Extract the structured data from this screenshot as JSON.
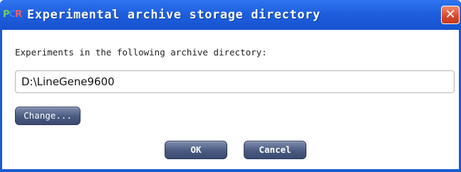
{
  "window": {
    "app_logo": {
      "p": "P",
      "c": "C",
      "r": "R"
    },
    "title": "Experimental archive storage directory",
    "close_glyph": "✕",
    "accent_color": "#1a5bd0"
  },
  "form": {
    "label": "Experiments in the following archive directory:",
    "path_value": "D:\\LineGene9600",
    "change_button": "Change...",
    "ok_button": "OK",
    "cancel_button": "Cancel"
  }
}
